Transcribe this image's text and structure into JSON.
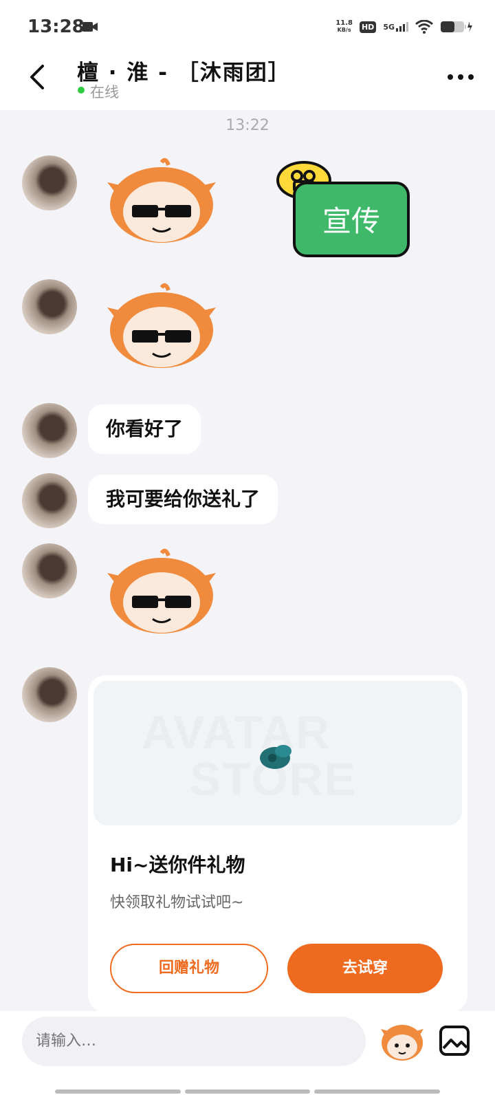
{
  "status_bar": {
    "time": "13:28",
    "net_speed_value": "11.8",
    "net_speed_unit": "KB/s",
    "hd": "HD",
    "signal": "5G"
  },
  "header": {
    "title": "檀 · 淮 - ［沐雨团］",
    "status": "在线"
  },
  "chat": {
    "time_divider": "13:22",
    "promo_text": "宣传",
    "messages": [
      {
        "type": "sticker",
        "name": "sunglasses-mascot-sticker"
      },
      {
        "type": "sticker",
        "name": "sunglasses-mascot-sticker"
      },
      {
        "type": "text",
        "text": "你看好了"
      },
      {
        "type": "text",
        "text": "我可要给你送礼了"
      },
      {
        "type": "sticker",
        "name": "sunglasses-mascot-sticker"
      }
    ]
  },
  "gift_card": {
    "watermark_line1": "AVATAR",
    "watermark_line2": "STORE",
    "title": "Hi~送你件礼物",
    "subtitle": "快领取礼物试试吧~",
    "return_button": "回赠礼物",
    "try_button": "去试穿"
  },
  "composer": {
    "placeholder": "请输入…"
  },
  "colors": {
    "accent": "#ee6a1f",
    "online": "#2ecc40",
    "chat_bg": "#f3f3f8",
    "promo_green": "#3fb86a"
  }
}
